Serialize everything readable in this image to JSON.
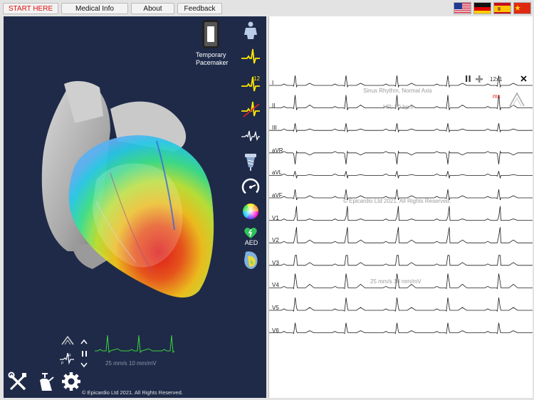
{
  "nav": {
    "start": "START HERE",
    "medical": "Medical Info",
    "about": "About",
    "feedback": "Feedback"
  },
  "flags": [
    "flag-us-icon",
    "flag-de-icon",
    "flag-es-icon",
    "flag-cn-icon"
  ],
  "colors": {
    "panel": "#1e2a48",
    "ecg_trace": "#1a1a1a",
    "monitor_trace": "#3bd13b",
    "accent_red": "#dd1111",
    "icon_yellow": "#ffe800"
  },
  "left_panel": {
    "pacemaker_label": "Temporary\nPacemaker",
    "aed_label": "AED",
    "speed_text": "25 mm/s  10 mm/mV",
    "copyright": "© Epicardio Ltd 2021. All Rights Reserved.",
    "side_icons": [
      "body-figure-icon",
      "ecg-single-lead-icon",
      "ecg-12-lead-icon",
      "ecg-arrhythmia-icon",
      "ecg-rhythm-icon",
      "pressure-icon",
      "gauge-icon",
      "color-wheel-icon",
      "aed-heart-icon",
      "heart-map-icon"
    ],
    "tools": [
      "tools-icon",
      "syringe-icon",
      "settings-gear-icon"
    ]
  },
  "ecg": {
    "layout_label": "12x1",
    "rhythm": "Sinus Rhythm, Normal Axis",
    "hr": "HR: 70 bpm",
    "ms_label": "ms",
    "watermark": "© Epicardio Ltd 2021. All Rights Reserved.",
    "speed": "25 mm/s  10 mm/mV",
    "leads": [
      "I",
      "II",
      "III",
      "aVR",
      "aVL",
      "aVF",
      "V1",
      "V2",
      "V3",
      "V4",
      "V5",
      "V6"
    ]
  }
}
